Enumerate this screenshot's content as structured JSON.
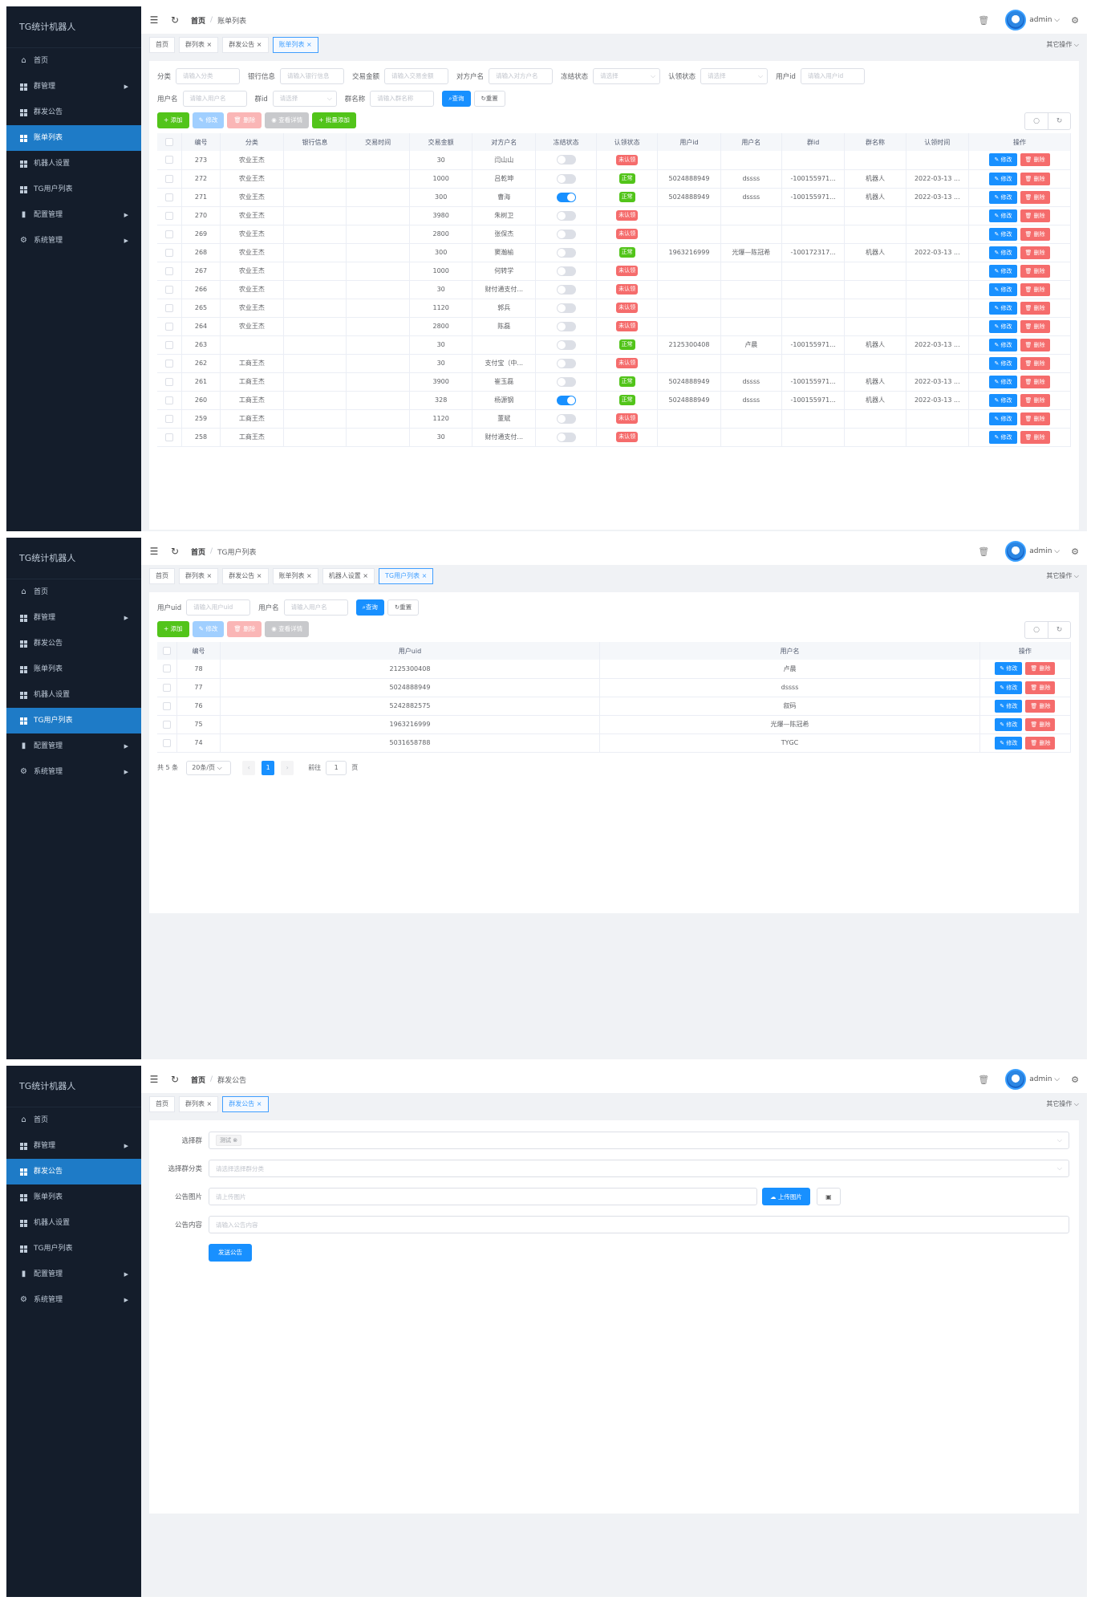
{
  "app": {
    "title": "TG统计机器人",
    "user": "admin",
    "other_ops": "其它操作",
    "breadcrumb_home": "首页"
  },
  "menu": [
    {
      "label": "首页",
      "icon": "home-icon",
      "has_arrow": false
    },
    {
      "label": "群管理",
      "icon": "grid-icon",
      "has_arrow": true
    },
    {
      "label": "群发公告",
      "icon": "grid-icon",
      "has_arrow": false
    },
    {
      "label": "账单列表",
      "icon": "grid-icon",
      "has_arrow": false
    },
    {
      "label": "机器人设置",
      "icon": "grid-icon",
      "has_arrow": false
    },
    {
      "label": "TG用户列表",
      "icon": "grid-icon",
      "has_arrow": false
    },
    {
      "label": "配置管理",
      "icon": "bar-chart-icon",
      "has_arrow": true
    },
    {
      "label": "系统管理",
      "icon": "settings-icon",
      "has_arrow": true
    }
  ],
  "panel1": {
    "active_menu": 3,
    "breadcrumb": "账单列表",
    "tabs": [
      {
        "label": "首页",
        "closable": false,
        "active": false
      },
      {
        "label": "群列表",
        "closable": true,
        "active": false
      },
      {
        "label": "群发公告",
        "closable": true,
        "active": false
      },
      {
        "label": "账单列表",
        "closable": true,
        "active": true
      }
    ],
    "filters_row1": [
      {
        "label": "分类",
        "placeholder": "请输入分类",
        "type": "input"
      },
      {
        "label": "银行信息",
        "placeholder": "请输入银行信息",
        "type": "input"
      },
      {
        "label": "交易金额",
        "placeholder": "请输入交易金额",
        "type": "input"
      },
      {
        "label": "对方户名",
        "placeholder": "请输入对方户名",
        "type": "input"
      },
      {
        "label": "冻结状态",
        "placeholder": "请选择",
        "type": "select"
      },
      {
        "label": "认领状态",
        "placeholder": "请选择",
        "type": "select"
      },
      {
        "label": "用户id",
        "placeholder": "请输入用户id",
        "type": "input"
      }
    ],
    "filters_row2": [
      {
        "label": "用户名",
        "placeholder": "请输入用户名",
        "type": "input"
      },
      {
        "label": "群id",
        "placeholder": "请选择",
        "type": "select"
      },
      {
        "label": "群名称",
        "placeholder": "请输入群名称",
        "type": "input"
      }
    ],
    "search_label": "查询",
    "reset_label": "重置",
    "toolbar": {
      "add": "添加",
      "edit": "修改",
      "delete": "删除",
      "view": "查看详情",
      "batch_add": "批量添加"
    },
    "columns": [
      "编号",
      "分类",
      "银行信息",
      "交易时间",
      "交易金额",
      "对方户名",
      "冻结状态",
      "认领状态",
      "用户id",
      "用户名",
      "群id",
      "群名称",
      "认领时间",
      "操作"
    ],
    "rows": [
      {
        "id": "273",
        "category": "农业王杰",
        "bank": "",
        "time": "",
        "amount": "30",
        "payee": "闫山山",
        "frozen": false,
        "claim": "未认领",
        "claimed": false,
        "uid": "",
        "uname": "",
        "gid": "",
        "gname": "",
        "ctime": ""
      },
      {
        "id": "272",
        "category": "农业王杰",
        "bank": "",
        "time": "",
        "amount": "1000",
        "payee": "吕乾坤",
        "frozen": false,
        "claim": "正常",
        "claimed": true,
        "uid": "5024888949",
        "uname": "dssss",
        "gid": "-100155971...",
        "gname": "机器人",
        "ctime": "2022-03-13 ..."
      },
      {
        "id": "271",
        "category": "农业王杰",
        "bank": "",
        "time": "",
        "amount": "300",
        "payee": "曹海",
        "frozen": true,
        "claim": "正常",
        "claimed": true,
        "uid": "5024888949",
        "uname": "dssss",
        "gid": "-100155971...",
        "gname": "机器人",
        "ctime": "2022-03-13 ..."
      },
      {
        "id": "270",
        "category": "农业王杰",
        "bank": "",
        "time": "",
        "amount": "3980",
        "payee": "朱树卫",
        "frozen": false,
        "claim": "未认领",
        "claimed": false,
        "uid": "",
        "uname": "",
        "gid": "",
        "gname": "",
        "ctime": ""
      },
      {
        "id": "269",
        "category": "农业王杰",
        "bank": "",
        "time": "",
        "amount": "2800",
        "payee": "张保杰",
        "frozen": false,
        "claim": "未认领",
        "claimed": false,
        "uid": "",
        "uname": "",
        "gid": "",
        "gname": "",
        "ctime": ""
      },
      {
        "id": "268",
        "category": "农业王杰",
        "bank": "",
        "time": "",
        "amount": "300",
        "payee": "窦瀚榆",
        "frozen": false,
        "claim": "正常",
        "claimed": true,
        "uid": "1963216999",
        "uname": "光爆—陈冠希",
        "gid": "-100172317...",
        "gname": "机器人",
        "ctime": "2022-03-13 ..."
      },
      {
        "id": "267",
        "category": "农业王杰",
        "bank": "",
        "time": "",
        "amount": "1000",
        "payee": "何转学",
        "frozen": false,
        "claim": "未认领",
        "claimed": false,
        "uid": "",
        "uname": "",
        "gid": "",
        "gname": "",
        "ctime": ""
      },
      {
        "id": "266",
        "category": "农业王杰",
        "bank": "",
        "time": "",
        "amount": "30",
        "payee": "财付通支付...",
        "frozen": false,
        "claim": "未认领",
        "claimed": false,
        "uid": "",
        "uname": "",
        "gid": "",
        "gname": "",
        "ctime": ""
      },
      {
        "id": "265",
        "category": "农业王杰",
        "bank": "",
        "time": "",
        "amount": "1120",
        "payee": "郭兵",
        "frozen": false,
        "claim": "未认领",
        "claimed": false,
        "uid": "",
        "uname": "",
        "gid": "",
        "gname": "",
        "ctime": ""
      },
      {
        "id": "264",
        "category": "农业王杰",
        "bank": "",
        "time": "",
        "amount": "2800",
        "payee": "陈磊",
        "frozen": false,
        "claim": "未认领",
        "claimed": false,
        "uid": "",
        "uname": "",
        "gid": "",
        "gname": "",
        "ctime": ""
      },
      {
        "id": "263",
        "category": "",
        "bank": "",
        "time": "",
        "amount": "30",
        "payee": "",
        "frozen": false,
        "claim": "正常",
        "claimed": true,
        "uid": "2125300408",
        "uname": "卢晨",
        "gid": "-100155971...",
        "gname": "机器人",
        "ctime": "2022-03-13 ..."
      },
      {
        "id": "262",
        "category": "工商王杰",
        "bank": "",
        "time": "",
        "amount": "30",
        "payee": "支付宝（中...",
        "frozen": false,
        "claim": "未认领",
        "claimed": false,
        "uid": "",
        "uname": "",
        "gid": "",
        "gname": "",
        "ctime": ""
      },
      {
        "id": "261",
        "category": "工商王杰",
        "bank": "",
        "time": "",
        "amount": "3900",
        "payee": "崔玉磊",
        "frozen": false,
        "claim": "正常",
        "claimed": true,
        "uid": "5024888949",
        "uname": "dssss",
        "gid": "-100155971...",
        "gname": "机器人",
        "ctime": "2022-03-13 ..."
      },
      {
        "id": "260",
        "category": "工商王杰",
        "bank": "",
        "time": "",
        "amount": "328",
        "payee": "杨源钢",
        "frozen": true,
        "claim": "正常",
        "claimed": true,
        "uid": "5024888949",
        "uname": "dssss",
        "gid": "-100155971...",
        "gname": "机器人",
        "ctime": "2022-03-13 ..."
      },
      {
        "id": "259",
        "category": "工商王杰",
        "bank": "",
        "time": "",
        "amount": "1120",
        "payee": "董斌",
        "frozen": false,
        "claim": "未认领",
        "claimed": false,
        "uid": "",
        "uname": "",
        "gid": "",
        "gname": "",
        "ctime": ""
      },
      {
        "id": "258",
        "category": "工商王杰",
        "bank": "",
        "time": "",
        "amount": "30",
        "payee": "财付通支付...",
        "frozen": false,
        "claim": "未认领",
        "claimed": false,
        "uid": "",
        "uname": "",
        "gid": "",
        "gname": "",
        "ctime": ""
      }
    ],
    "row_edit": "修改",
    "row_delete": "删除"
  },
  "panel2": {
    "active_menu": 5,
    "breadcrumb": "TG用户列表",
    "tabs": [
      {
        "label": "首页",
        "closable": false,
        "active": false
      },
      {
        "label": "群列表",
        "closable": true,
        "active": false
      },
      {
        "label": "群发公告",
        "closable": true,
        "active": false
      },
      {
        "label": "账单列表",
        "closable": true,
        "active": false
      },
      {
        "label": "机器人设置",
        "closable": true,
        "active": false
      },
      {
        "label": "TG用户列表",
        "closable": true,
        "active": true
      }
    ],
    "filters": [
      {
        "label": "用户uid",
        "placeholder": "请输入用户uid"
      },
      {
        "label": "用户名",
        "placeholder": "请输入用户名"
      }
    ],
    "search_label": "查询",
    "reset_label": "重置",
    "toolbar": {
      "add": "添加",
      "edit": "修改",
      "delete": "删除",
      "view": "查看详情"
    },
    "columns": [
      "编号",
      "用户uid",
      "用户名",
      "操作"
    ],
    "rows": [
      {
        "id": "78",
        "uid": "2125300408",
        "uname": "卢晨"
      },
      {
        "id": "77",
        "uid": "5024888949",
        "uname": "dssss"
      },
      {
        "id": "76",
        "uid": "5242882575",
        "uname": "叙码"
      },
      {
        "id": "75",
        "uid": "1963216999",
        "uname": "光爆—陈冠希"
      },
      {
        "id": "74",
        "uid": "5031658788",
        "uname": "TYGC"
      }
    ],
    "row_edit": "修改",
    "row_delete": "删除",
    "pager": {
      "total": "共 5 条",
      "page_size": "20条/页",
      "current": "1",
      "goto_label": "前往",
      "goto_value": "1",
      "page_unit": "页"
    }
  },
  "panel3": {
    "active_menu": 2,
    "breadcrumb": "群发公告",
    "tabs": [
      {
        "label": "首页",
        "closable": false,
        "active": false
      },
      {
        "label": "群列表",
        "closable": true,
        "active": false
      },
      {
        "label": "群发公告",
        "closable": true,
        "active": true
      }
    ],
    "form": {
      "group_label": "选择群",
      "group_chip": "测试",
      "category_label": "选择群分类",
      "category_placeholder": "请选择选择群分类",
      "image_label": "公告图片",
      "image_placeholder": "请上传图片",
      "upload_label": "上传图片",
      "content_label": "公告内容",
      "content_placeholder": "请输入公告内容",
      "submit_label": "发送公告"
    }
  },
  "colors": {
    "sidebar_bg": "#141d2b",
    "active_menu": "#1e7bc7",
    "primary": "#1890ff",
    "success": "#52c41a",
    "danger": "#f56c6c"
  }
}
